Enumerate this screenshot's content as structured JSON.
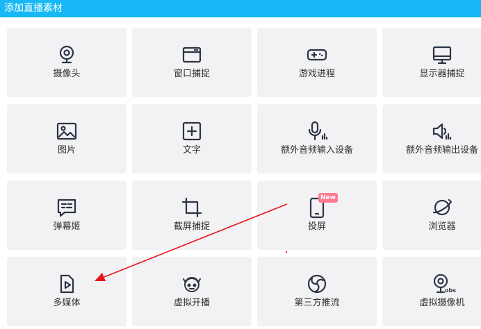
{
  "window": {
    "title": "添加直播素材"
  },
  "tiles": [
    {
      "label": "摄像头",
      "icon": "webcam-icon"
    },
    {
      "label": "窗口捕捉",
      "icon": "window-icon"
    },
    {
      "label": "游戏进程",
      "icon": "gamepad-icon"
    },
    {
      "label": "显示器捕捉",
      "icon": "monitor-icon"
    },
    {
      "label": "图片",
      "icon": "image-icon"
    },
    {
      "label": "文字",
      "icon": "text-plus-icon"
    },
    {
      "label": "额外音频输入设备",
      "icon": "microphone-icon"
    },
    {
      "label": "额外音频输出设备",
      "icon": "speaker-icon"
    },
    {
      "label": "弹幕姬",
      "icon": "danmaku-chat-icon"
    },
    {
      "label": "截屏捕捉",
      "icon": "crop-icon"
    },
    {
      "label": "投屏",
      "icon": "phone-cast-icon",
      "badge": "New"
    },
    {
      "label": "浏览器",
      "icon": "browser-globe-icon"
    },
    {
      "label": "多媒体",
      "icon": "media-file-icon"
    },
    {
      "label": "虚拟开播",
      "icon": "virtual-avatar-icon"
    },
    {
      "label": "第三方推流",
      "icon": "third-party-stream-icon"
    },
    {
      "label": "虚拟摄像机",
      "icon": "obs-virtual-camera-icon"
    }
  ],
  "annotation": {
    "color": "#e8141c"
  },
  "colors": {
    "titlebar": "#17b8f5",
    "tile_bg": "#f2f2f4",
    "icon": "#2b3445",
    "badge": "#ff7a93"
  }
}
